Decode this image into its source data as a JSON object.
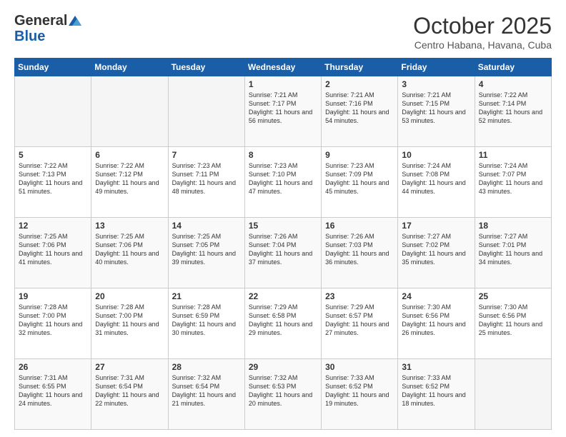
{
  "header": {
    "logo_general": "General",
    "logo_blue": "Blue",
    "month_title": "October 2025",
    "location": "Centro Habana, Havana, Cuba"
  },
  "weekdays": [
    "Sunday",
    "Monday",
    "Tuesday",
    "Wednesday",
    "Thursday",
    "Friday",
    "Saturday"
  ],
  "weeks": [
    [
      {
        "day": "",
        "text": ""
      },
      {
        "day": "",
        "text": ""
      },
      {
        "day": "",
        "text": ""
      },
      {
        "day": "1",
        "text": "Sunrise: 7:21 AM\nSunset: 7:17 PM\nDaylight: 11 hours and 56 minutes."
      },
      {
        "day": "2",
        "text": "Sunrise: 7:21 AM\nSunset: 7:16 PM\nDaylight: 11 hours and 54 minutes."
      },
      {
        "day": "3",
        "text": "Sunrise: 7:21 AM\nSunset: 7:15 PM\nDaylight: 11 hours and 53 minutes."
      },
      {
        "day": "4",
        "text": "Sunrise: 7:22 AM\nSunset: 7:14 PM\nDaylight: 11 hours and 52 minutes."
      }
    ],
    [
      {
        "day": "5",
        "text": "Sunrise: 7:22 AM\nSunset: 7:13 PM\nDaylight: 11 hours and 51 minutes."
      },
      {
        "day": "6",
        "text": "Sunrise: 7:22 AM\nSunset: 7:12 PM\nDaylight: 11 hours and 49 minutes."
      },
      {
        "day": "7",
        "text": "Sunrise: 7:23 AM\nSunset: 7:11 PM\nDaylight: 11 hours and 48 minutes."
      },
      {
        "day": "8",
        "text": "Sunrise: 7:23 AM\nSunset: 7:10 PM\nDaylight: 11 hours and 47 minutes."
      },
      {
        "day": "9",
        "text": "Sunrise: 7:23 AM\nSunset: 7:09 PM\nDaylight: 11 hours and 45 minutes."
      },
      {
        "day": "10",
        "text": "Sunrise: 7:24 AM\nSunset: 7:08 PM\nDaylight: 11 hours and 44 minutes."
      },
      {
        "day": "11",
        "text": "Sunrise: 7:24 AM\nSunset: 7:07 PM\nDaylight: 11 hours and 43 minutes."
      }
    ],
    [
      {
        "day": "12",
        "text": "Sunrise: 7:25 AM\nSunset: 7:06 PM\nDaylight: 11 hours and 41 minutes."
      },
      {
        "day": "13",
        "text": "Sunrise: 7:25 AM\nSunset: 7:06 PM\nDaylight: 11 hours and 40 minutes."
      },
      {
        "day": "14",
        "text": "Sunrise: 7:25 AM\nSunset: 7:05 PM\nDaylight: 11 hours and 39 minutes."
      },
      {
        "day": "15",
        "text": "Sunrise: 7:26 AM\nSunset: 7:04 PM\nDaylight: 11 hours and 37 minutes."
      },
      {
        "day": "16",
        "text": "Sunrise: 7:26 AM\nSunset: 7:03 PM\nDaylight: 11 hours and 36 minutes."
      },
      {
        "day": "17",
        "text": "Sunrise: 7:27 AM\nSunset: 7:02 PM\nDaylight: 11 hours and 35 minutes."
      },
      {
        "day": "18",
        "text": "Sunrise: 7:27 AM\nSunset: 7:01 PM\nDaylight: 11 hours and 34 minutes."
      }
    ],
    [
      {
        "day": "19",
        "text": "Sunrise: 7:28 AM\nSunset: 7:00 PM\nDaylight: 11 hours and 32 minutes."
      },
      {
        "day": "20",
        "text": "Sunrise: 7:28 AM\nSunset: 7:00 PM\nDaylight: 11 hours and 31 minutes."
      },
      {
        "day": "21",
        "text": "Sunrise: 7:28 AM\nSunset: 6:59 PM\nDaylight: 11 hours and 30 minutes."
      },
      {
        "day": "22",
        "text": "Sunrise: 7:29 AM\nSunset: 6:58 PM\nDaylight: 11 hours and 29 minutes."
      },
      {
        "day": "23",
        "text": "Sunrise: 7:29 AM\nSunset: 6:57 PM\nDaylight: 11 hours and 27 minutes."
      },
      {
        "day": "24",
        "text": "Sunrise: 7:30 AM\nSunset: 6:56 PM\nDaylight: 11 hours and 26 minutes."
      },
      {
        "day": "25",
        "text": "Sunrise: 7:30 AM\nSunset: 6:56 PM\nDaylight: 11 hours and 25 minutes."
      }
    ],
    [
      {
        "day": "26",
        "text": "Sunrise: 7:31 AM\nSunset: 6:55 PM\nDaylight: 11 hours and 24 minutes."
      },
      {
        "day": "27",
        "text": "Sunrise: 7:31 AM\nSunset: 6:54 PM\nDaylight: 11 hours and 22 minutes."
      },
      {
        "day": "28",
        "text": "Sunrise: 7:32 AM\nSunset: 6:54 PM\nDaylight: 11 hours and 21 minutes."
      },
      {
        "day": "29",
        "text": "Sunrise: 7:32 AM\nSunset: 6:53 PM\nDaylight: 11 hours and 20 minutes."
      },
      {
        "day": "30",
        "text": "Sunrise: 7:33 AM\nSunset: 6:52 PM\nDaylight: 11 hours and 19 minutes."
      },
      {
        "day": "31",
        "text": "Sunrise: 7:33 AM\nSunset: 6:52 PM\nDaylight: 11 hours and 18 minutes."
      },
      {
        "day": "",
        "text": ""
      }
    ]
  ]
}
